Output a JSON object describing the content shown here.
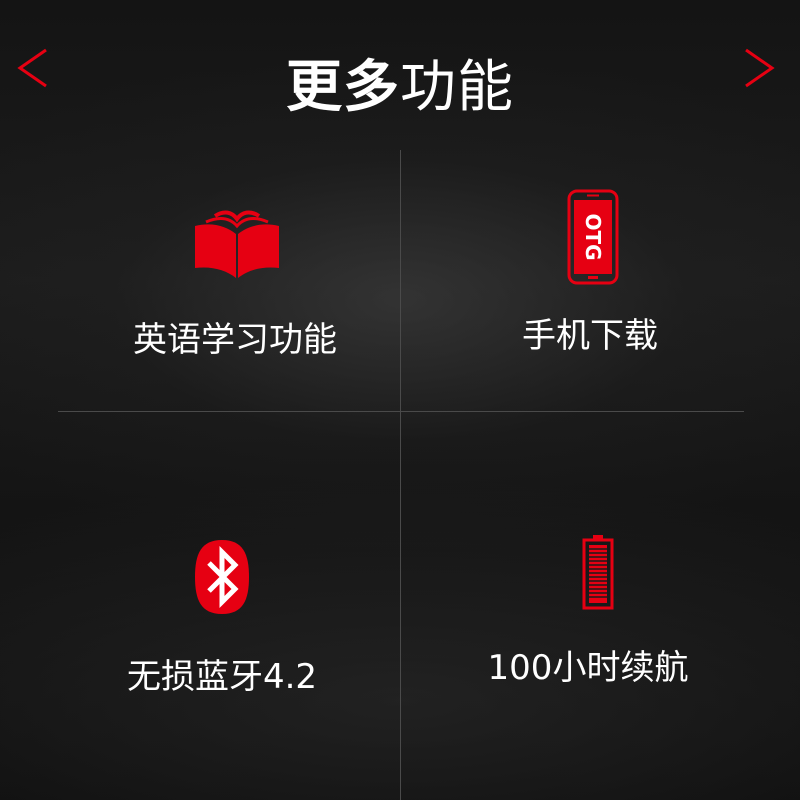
{
  "header": {
    "title_bold": "更多",
    "title_light": "功能"
  },
  "navigation": {
    "prev_icon": "chevron-left-icon",
    "next_icon": "chevron-right-icon"
  },
  "features": [
    {
      "label": "英语学习功能",
      "icon": "book-icon"
    },
    {
      "label": "手机下载",
      "icon": "otg-phone-icon",
      "icon_text": "OTG"
    },
    {
      "label": "无损蓝牙4.2",
      "icon": "bluetooth-icon"
    },
    {
      "label": "100小时续航",
      "icon": "battery-icon"
    }
  ],
  "colors": {
    "accent": "#e60012",
    "text": "#ffffff",
    "divider": "#4a4a4a",
    "background": "#151515"
  }
}
